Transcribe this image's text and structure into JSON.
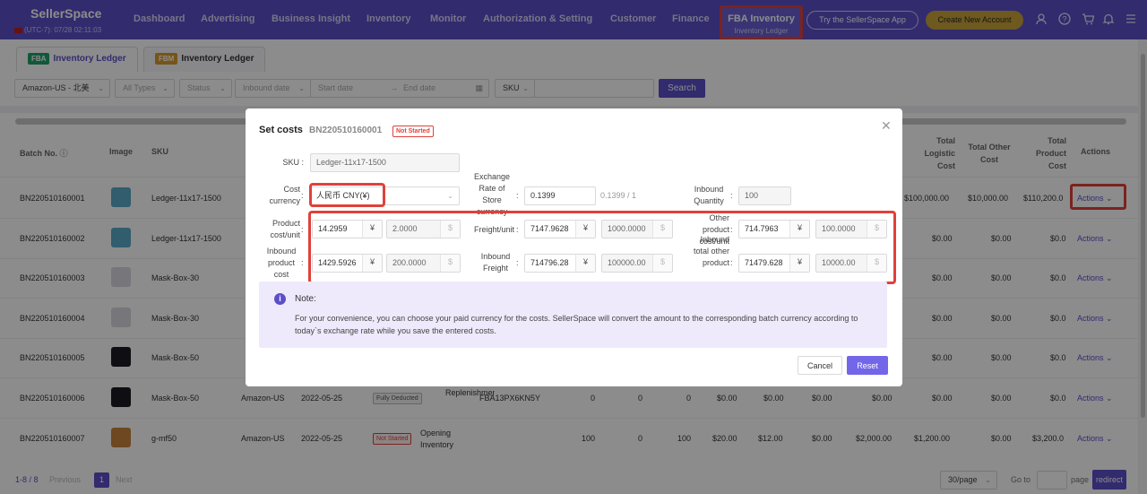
{
  "nav": {
    "logo": "SellerSpace",
    "timezone": "(UTC-7): 07/28 02:11:03",
    "items": [
      "Dashboard",
      "Advertising",
      "Business Insight",
      "Inventory",
      "Monitor",
      "Authorization & Setting",
      "Customer",
      "Finance"
    ],
    "active_title": "FBA Inventory",
    "active_sub": "Inventory Ledger",
    "try_app": "Try the SellerSpace App",
    "create_account": "Create New Account",
    "icons": [
      "user-icon",
      "help-icon",
      "cart-icon",
      "bell-icon",
      "menu-icon"
    ]
  },
  "tabs": [
    {
      "tag": "FBA",
      "label": "Inventory Ledger",
      "tag_color": "#22a06b"
    },
    {
      "tag": "FBM",
      "label": "Inventory Ledger",
      "tag_color": "#d99a2b"
    }
  ],
  "filters": {
    "marketplace": "Amazon-US - 北美",
    "types": "All Types",
    "status": "Status",
    "date_field": "Inbound date",
    "start_date": "Start date",
    "end_date": "End date",
    "sku_select": "SKU",
    "search": "Search"
  },
  "table": {
    "headers": {
      "batch": "Batch No.",
      "image": "Image",
      "sku": "SKU",
      "total_logistic": "Total Logistic Cost",
      "total_other": "Total Other Cost",
      "total_product": "Total Product Cost",
      "actions": "Actions"
    },
    "rows": [
      {
        "batch": "BN220510160001",
        "sku": "Ledger-11x17-1500",
        "logistic": "$100,000.00",
        "other": "$10,000.00",
        "product": "$110,200.0",
        "actions": "Actions ⌄"
      },
      {
        "batch": "BN220510160002",
        "sku": "Ledger-11x17-1500",
        "logistic": "$0.00",
        "other": "$0.00",
        "product": "$0.0",
        "actions": "Actions ⌄"
      },
      {
        "batch": "BN220510160003",
        "sku": "Mask-Box-30",
        "logistic": "$0.00",
        "other": "$0.00",
        "product": "$0.0",
        "actions": "Actions ⌄"
      },
      {
        "batch": "BN220510160004",
        "sku": "Mask-Box-30",
        "logistic": "$0.00",
        "other": "$0.00",
        "product": "$0.0",
        "actions": "Actions ⌄"
      },
      {
        "batch": "BN220510160005",
        "sku": "Mask-Box-50",
        "logistic": "$0.00",
        "other": "$0.00",
        "product": "$0.0",
        "actions": "Actions ⌄"
      },
      {
        "batch": "BN220510160006",
        "sku": "Mask-Box-50",
        "logistic": "$0.00",
        "other": "$0.00",
        "product": "$0.0",
        "actions": "Actions ⌄"
      },
      {
        "batch": "BN220510160007",
        "sku": "g-mf50",
        "logistic": "$1,200.00",
        "other": "$0.00",
        "product": "$3,200.0",
        "actions": "Actions ⌄"
      }
    ],
    "row6_extra": {
      "market": "Amazon-US",
      "date": "2022-05-25",
      "status": "Fully Deducted",
      "type": "Replenishment",
      "fnsku": "FBA13PX6KN5Y",
      "c1": "0",
      "c2": "0",
      "c3": "0",
      "c4": "$0.00",
      "c5": "$0.00",
      "c6": "$0.00",
      "c7": "$0.00"
    },
    "row7_extra": {
      "market": "Amazon-US",
      "date": "2022-05-25",
      "status": "Not Started",
      "type": "Opening Inventory",
      "c1": "100",
      "c2": "0",
      "c3": "100",
      "c4": "$20.00",
      "c5": "$12.00",
      "c6": "$0.00",
      "c7": "$2,000.00"
    }
  },
  "footer": {
    "range": "1-8 / 8",
    "previous": "Previous",
    "page": "1",
    "next": "Next",
    "per_page": "30/page",
    "goto": "Go to",
    "page_label": "page",
    "redirect": "redirect"
  },
  "modal": {
    "title": "Set costs",
    "batch": "BN220510160001",
    "status": "Not Started",
    "sku_label": "SKU",
    "sku_value": "Ledger-11x17-1500",
    "currency_label": "Cost currency",
    "currency_value": "人民币 CNY(¥)",
    "exchange_label": "Exchange Rate of Store currency",
    "exchange_value": "0.1399",
    "exchange_hint": "0.1399 / 1",
    "inbound_qty_label": "Inbound Quantity",
    "inbound_qty_value": "100",
    "product_cost_label": "Product cost/unit",
    "product_cost_value": "14.2959",
    "product_cost_usd": "2.0000",
    "freight_unit_label": "Freight/unit",
    "freight_unit_value": "7147.9628",
    "freight_unit_usd": "1000.0000",
    "other_unit_label": "Other product cost/unit",
    "other_unit_value": "714.7963",
    "other_unit_usd": "100.0000",
    "inbound_product_label": "Inbound product cost",
    "inbound_product_value": "1429.5926",
    "inbound_product_usd": "200.0000",
    "inbound_freight_label": "Inbound Freight",
    "inbound_freight_value": "714796.28",
    "inbound_freight_usd": "100000.00",
    "inbound_other_label": "Inbound total other product",
    "inbound_other_value": "71479.628",
    "inbound_other_usd": "10000.00",
    "cny_symbol": "¥",
    "usd_symbol": "$",
    "note_title": "Note:",
    "note_text": "For your convenience, you can choose your paid currency for the costs. SellerSpace will convert the amount to the corresponding batch currency according to today`s exchange rate while you save the entered costs.",
    "cancel": "Cancel",
    "reset": "Reset"
  }
}
